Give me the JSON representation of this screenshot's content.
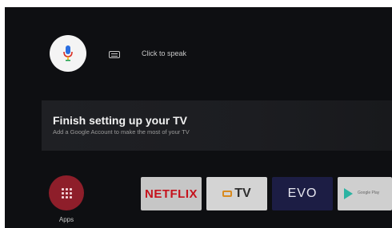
{
  "search": {
    "mic_icon": "microphone-icon",
    "keyboard_icon": "keyboard-icon",
    "prompt": "Click to speak"
  },
  "setup_card": {
    "title": "Finish setting up your TV",
    "subtitle": "Add a Google Account to make the most of your TV"
  },
  "apps": {
    "label": "Apps",
    "icon": "grid-icon",
    "color": "#8e1e2a"
  },
  "app_row": [
    {
      "name": "NETFLIX"
    },
    {
      "name": "TV"
    },
    {
      "name": "EVO"
    },
    {
      "name": "Google Play"
    }
  ],
  "colors": {
    "background": "#0e0f12",
    "netflix_red": "#c5121c",
    "mic_blue": "#2a6ee0",
    "mic_red": "#d93025",
    "play_teal": "#2bb3a2"
  }
}
